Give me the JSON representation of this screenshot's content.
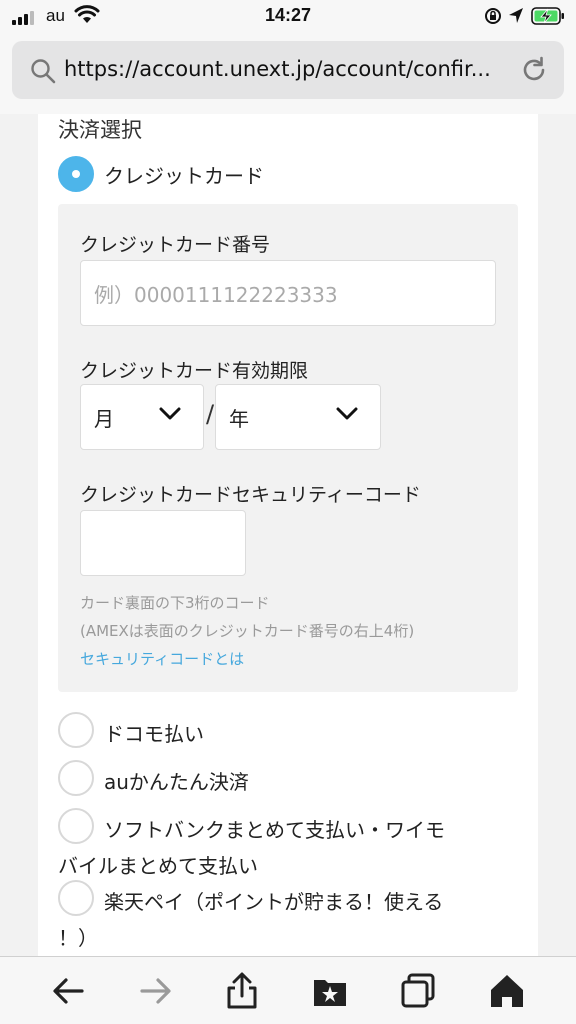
{
  "status_bar": {
    "carrier": "au",
    "time": "14:27"
  },
  "browser": {
    "url": "https://account.unext.jp/account/confir..."
  },
  "form": {
    "section_title": "決済選択",
    "credit_option_label": "クレジットカード",
    "card_number_label": "クレジットカード番号",
    "card_number_placeholder": "例）0000111122223333",
    "expiry_label": "クレジットカード有効期限",
    "month_value": "月",
    "separator": "/",
    "year_value": "年",
    "security_code_label": "クレジットカードセキュリティーコード",
    "security_help_line1": "カード裏面の下3桁のコード",
    "security_help_line2": "(AMEXは表面のクレジットカード番号の右上4桁)",
    "security_help_link": "セキュリティコードとは",
    "other_options": [
      {
        "line1": "ドコモ払い"
      },
      {
        "line1": "auかんたん決済"
      },
      {
        "line1": "ソフトバンクまとめて支払い・ワイモ",
        "line2": "バイルまとめて支払い"
      },
      {
        "line1": "楽天ペイ（ポイントが貯まる！使える",
        "line2": "！）"
      }
    ]
  },
  "colors": {
    "accent": "#4db5ea",
    "link": "#46a8dd"
  }
}
